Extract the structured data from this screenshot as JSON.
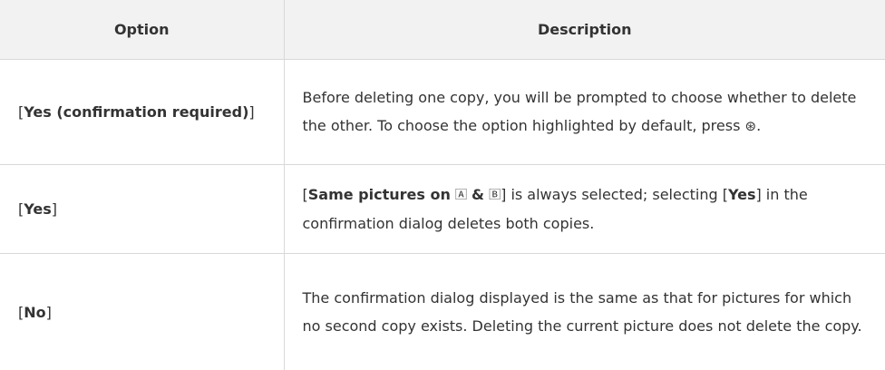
{
  "table": {
    "headers": {
      "option": "Option",
      "description": "Description"
    },
    "rows": [
      {
        "option": "Yes (confirmation required)",
        "description": {
          "before": "Before deleting one copy, you will be prompted to choose whether to delete the other. To choose the option highlighted by default, press ",
          "glyph": "⊛",
          "after": "."
        }
      },
      {
        "option": "Yes",
        "description": {
          "ref": "Same pictures on",
          "icon_a": "🄰",
          "amp": "&",
          "icon_b": "🄱",
          "middle": "] is always selected; selecting [",
          "ref2": "Yes",
          "after": "] in the confirmation dialog deletes both copies."
        }
      },
      {
        "option": "No",
        "description": {
          "text": "The confirmation dialog displayed is the same as that for pictures for which no second copy exists. Deleting the current picture does not delete the copy."
        }
      }
    ]
  }
}
